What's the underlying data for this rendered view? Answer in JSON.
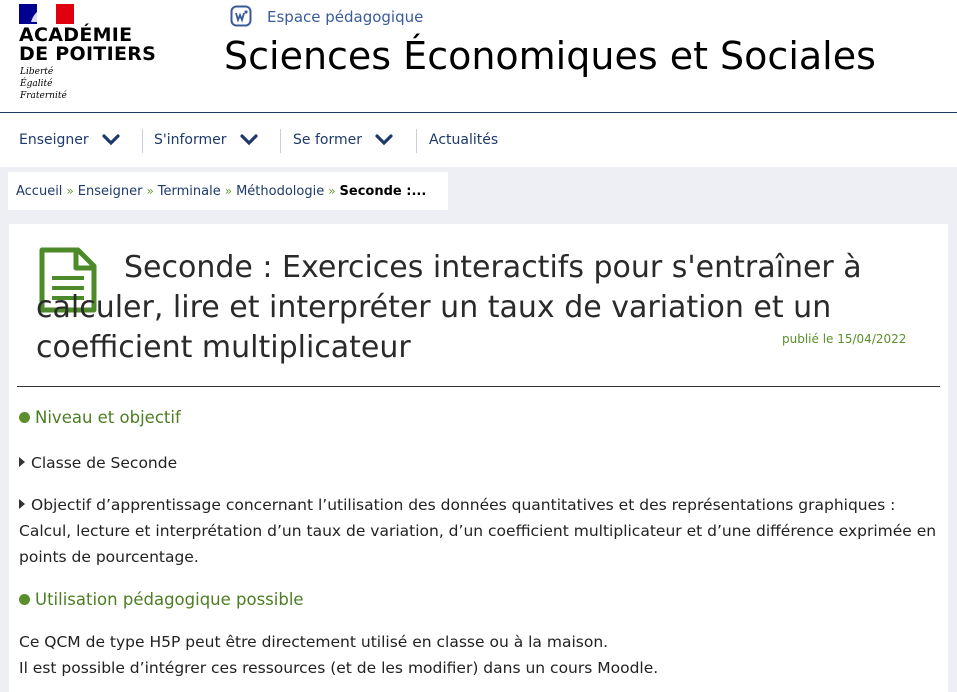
{
  "header": {
    "academy_line1": "ACADÉMIE",
    "academy_line2": "DE POITIERS",
    "motto": [
      "Liberté",
      "Égalité",
      "Fraternité"
    ],
    "space_label": "Espace pédagogique",
    "site_title": "Sciences Économiques et Sociales"
  },
  "nav": {
    "items": [
      {
        "label": "Enseigner",
        "has_menu": true
      },
      {
        "label": "S'informer",
        "has_menu": true
      },
      {
        "label": "Se former",
        "has_menu": true
      },
      {
        "label": "Actualités",
        "has_menu": false
      }
    ]
  },
  "breadcrumb": {
    "items": [
      "Accueil",
      "Enseigner",
      "Terminale",
      "Méthodologie"
    ],
    "current": "Seconde :...",
    "separator": "»"
  },
  "article": {
    "title": "Seconde : Exercices interactifs pour s'entraîner à calculer, lire et interpréter un taux de variation et un coefficient multiplicateur",
    "published": "publié le 15/04/2022",
    "section1_heading": "Niveau et objectif",
    "section1_item1": "Classe de Seconde",
    "section1_item2": "Objectif d’apprentissage concernant l’utilisation des données quantitatives et des représentations graphiques : Calcul, lecture et interprétation d’un taux de variation, d’un coefficient multiplicateur et d’une différence exprimée en points de pourcentage.",
    "section2_heading": "Utilisation pédagogique possible",
    "section2_line1": "Ce QCM de type H5P peut être directement utilisé en classe ou à la maison.",
    "section2_line2": "Il est possible d’intégrer ces ressources (et de les modifier) dans un cours Moodle."
  },
  "icons": {
    "nav_chevron": "chevron-down-icon",
    "doc": "document-icon",
    "space": "espace-pedagogique-icon"
  },
  "colors": {
    "accent_green": "#5b8f2b",
    "navy": "#1e3a6a",
    "flag_blue": "#000091",
    "flag_red": "#e1000f"
  }
}
